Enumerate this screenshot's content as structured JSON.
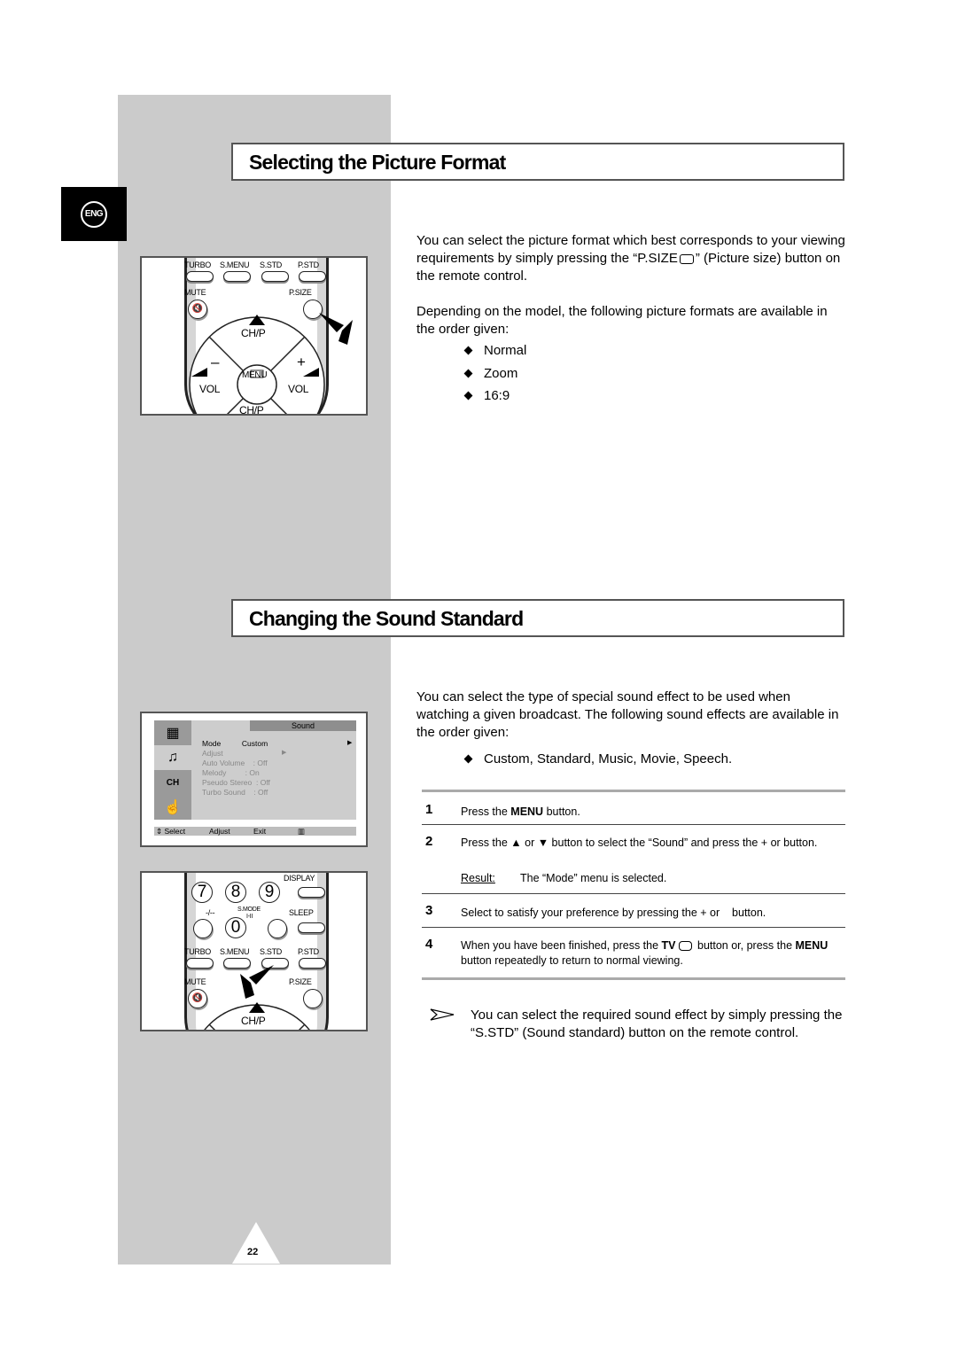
{
  "language_badge": "ENG",
  "page_number": "22",
  "section1": {
    "title": "Selecting the Picture Format",
    "intro_pre": "You can select the picture format which best corresponds to your viewing requirements by simply pressing the “P.SIZE",
    "intro_post": "” (Picture size) button on the remote control.",
    "formats_intro": "Depending on the model, the following picture formats are available in the order given:",
    "formats": [
      "Normal",
      "Zoom",
      "16:9"
    ]
  },
  "remote1": {
    "labels": [
      "TURBO",
      "S.MENU",
      "S.STD",
      "P.STD"
    ],
    "mute": "MUTE",
    "psize": "P.SIZE",
    "chp_up": "CH/P",
    "chp_down": "CH/P",
    "vol_minus": "–",
    "vol_plus": "+",
    "vol_left": "VOL",
    "vol_right": "VOL",
    "menu": "MENU"
  },
  "section2": {
    "title": "Changing the Sound Standard",
    "intro": "You can select the type of special sound effect to be used when watching a given broadcast. The following sound effects are available in the order given:",
    "effects": "Custom, Standard, Music, Movie, Speech.",
    "steps": [
      {
        "num": "1",
        "pre": "Press the ",
        "bold": "MENU",
        "post": " button."
      },
      {
        "num": "2",
        "text": "Press the ▲ or ▼ button to select the “Sound” and press the + or button.",
        "result_label": "Result:",
        "result_text": "The “Mode” menu is selected."
      },
      {
        "num": "3",
        "text": "Select to satisfy your preference by pressing the + or    button."
      },
      {
        "num": "4",
        "pre": "When you have been finished, press the ",
        "bold": "TV",
        "mid": " button or, press the ",
        "bold2": "MENU",
        "post": " button repeatedly to return to normal viewing."
      }
    ],
    "note": "You can select the required sound effect by simply pressing the “S.STD” (Sound standard) button on the remote control."
  },
  "osd": {
    "header": "Sound",
    "items": [
      {
        "label": "Mode",
        "value": "Custom"
      },
      {
        "label": "Adjust",
        "value": ""
      },
      {
        "label": "Auto Volume",
        "value": ": Off"
      },
      {
        "label": "Melody",
        "value": ": On"
      },
      {
        "label": "Pseudo Stereo",
        "value": ": Off"
      },
      {
        "label": "Turbo Sound",
        "value": ": Off"
      }
    ],
    "footer": {
      "select": "Select",
      "adjust": "Adjust",
      "exit": "Exit"
    }
  },
  "remote2": {
    "nums": [
      "7",
      "8",
      "9",
      "0"
    ],
    "display": "DISPLAY",
    "dash": "-/--",
    "smode": "S.MODE",
    "smode_sub": "I-II",
    "sleep": "SLEEP",
    "labels": [
      "TURBO",
      "S.MENU",
      "S.STD",
      "P.STD"
    ],
    "mute": "MUTE",
    "psize": "P.SIZE",
    "chp": "CH/P"
  }
}
